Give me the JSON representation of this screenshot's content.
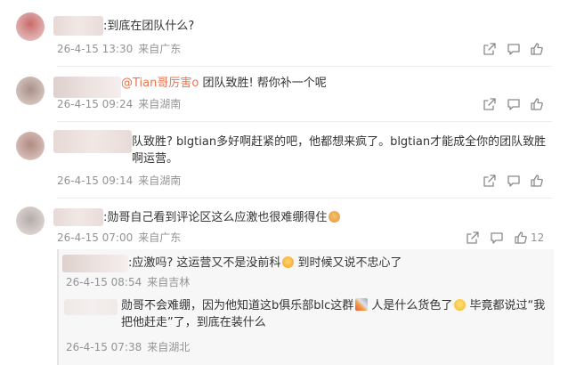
{
  "comments": [
    {
      "text": ":到底在团队什么?",
      "date": "26-4-15 13:30",
      "location": "来自广东"
    },
    {
      "mention": "@Tian哥厉害o",
      "text": " 团队致胜! 帮你补一个呢",
      "date": "26-4-15 09:24",
      "location": "来自湖南"
    },
    {
      "text": "队致胜? blgtian多好啊赶紧的吧，他都想来疯了。blgtian才能成全你的团队致胜啊运营。",
      "date": "26-4-15 09:14",
      "location": "来自湖南"
    },
    {
      "text": ":勋哥自己看到评论区这么应激也很难绷得住",
      "date": "26-4-15 07:00",
      "location": "来自广东",
      "like_count": "12"
    }
  ],
  "replies": [
    {
      "text_a": ":应激吗? 这运营又不是没前科",
      "text_b": " 到时候又说不忠心了",
      "date": "26-4-15 08:54",
      "location": "来自吉林"
    },
    {
      "text_a": "勋哥不会难绷，因为他知道这b俱乐部blc这群",
      "text_b": " 人是什么货色了",
      "text_c": " 毕竟都说过“我把他赶走”了，到底在装什么",
      "date": "26-4-15 07:38",
      "location": "来自湖北"
    }
  ],
  "icons": {
    "share": "share-icon",
    "comment": "comment-icon",
    "like": "thumbs-up-icon"
  },
  "colors": {
    "mention": "#eb7350",
    "meta": "#939393",
    "text": "#333333"
  }
}
